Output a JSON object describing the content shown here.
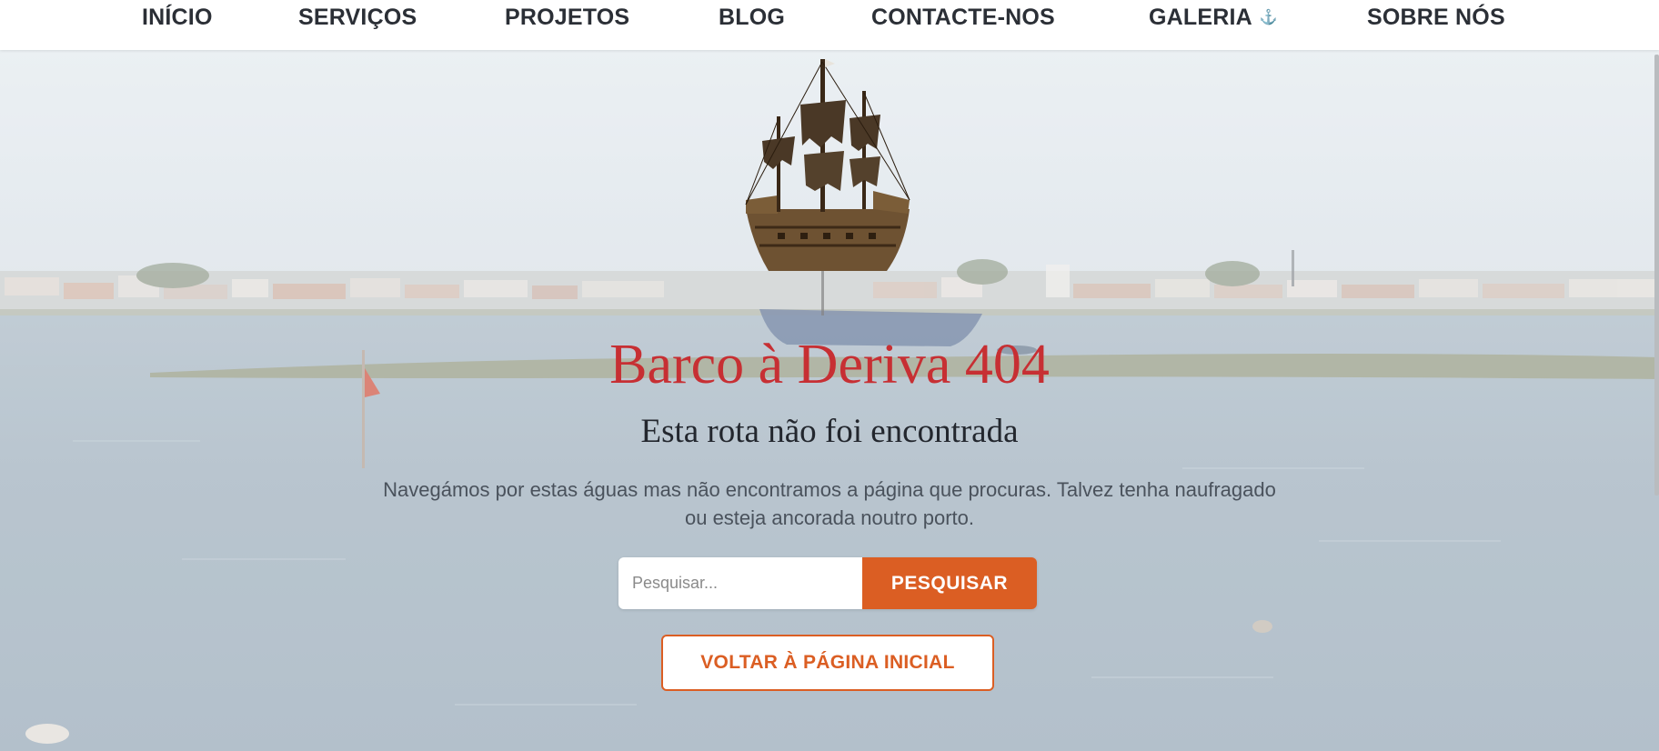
{
  "nav": {
    "items": [
      {
        "label": "INÍCIO"
      },
      {
        "label": "SERVIÇOS"
      },
      {
        "label": "PROJETOS"
      },
      {
        "label": "BLOG"
      },
      {
        "label": "CONTACTE-NOS"
      },
      {
        "label": "GALERIA",
        "icon": "anchor-icon",
        "icon_glyph": "⚓"
      },
      {
        "label": "SOBRE NÓS"
      }
    ]
  },
  "main": {
    "title": "Barco à Deriva 404",
    "subtitle": "Esta rota não foi encontrada",
    "description": "Navegámos por estas águas mas não encontramos a página que procuras. Talvez tenha naufragado ou esteja ancorada noutro porto.",
    "search": {
      "placeholder": "Pesquisar...",
      "value": "",
      "button_label": "PESQUISAR"
    },
    "home_button_label": "VOLTAR À PÁGINA INICIAL"
  },
  "colors": {
    "accent": "#db5e23",
    "title_red": "#c72f33",
    "nav_text": "#2b2f36"
  }
}
